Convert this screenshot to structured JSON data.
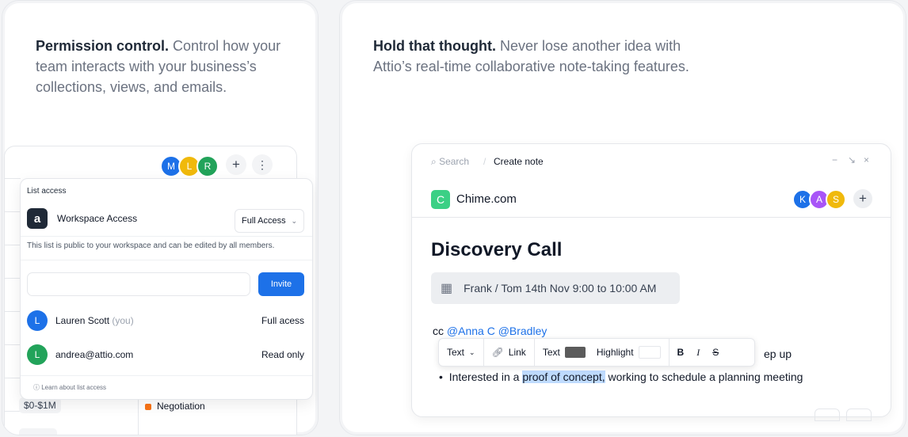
{
  "left_card": {
    "headline_bold": "Permission control.",
    "headline_rest": " Control how your team interacts with your business’s collections, views, and emails.",
    "avatars": [
      {
        "letter": "M",
        "color": "#1d71e8"
      },
      {
        "letter": "L",
        "color": "#f0b90b"
      },
      {
        "letter": "R",
        "color": "#22a35a"
      }
    ],
    "add_icon": "+",
    "more_icon": "⋮",
    "popup": {
      "section_label": "List access",
      "workspace_logo": "a",
      "workspace_label": "Workspace Access",
      "access_select": "Full Access",
      "description": "This list is public to your workspace and can be edited by all members.",
      "invite_placeholder": "",
      "invite_button": "Invite",
      "members": [
        {
          "initial": "L",
          "color": "#1d71e8",
          "name": "Lauren Scott",
          "suffix": "(you)",
          "role": "Full acess"
        },
        {
          "initial": "L",
          "color": "#22a35a",
          "name": "andrea@attio.com",
          "suffix": "",
          "role": "Read only"
        }
      ],
      "learn_more": "Learn about list access"
    },
    "table": {
      "amount_pill": "$0-$1M",
      "stage_label": "Negotiation"
    }
  },
  "right_card": {
    "headline_bold": "Hold that thought.",
    "headline_rest": " Never lose another idea with Attio’s real-time collaborative note-taking features.",
    "note": {
      "search_placeholder": "Search",
      "separator": "/",
      "crumb_current": "Create note",
      "win_minimize": "−",
      "win_collapse": "↘",
      "win_close": "×",
      "company_logo": "C",
      "company_name": "Chime.com",
      "collaborators": [
        {
          "letter": "K",
          "color": "#1d71e8"
        },
        {
          "letter": "A",
          "color": "#a855f7"
        },
        {
          "letter": "S",
          "color": "#f0b90b"
        }
      ],
      "add_icon": "+",
      "title": "Discovery Call",
      "date_chip": "Frank / Tom 14th Nov 9:00 to 10:00 AM",
      "cc_prefix": "cc ",
      "mentions": "@Anna C @Bradley",
      "hidden_tail": "ep up",
      "bullet_pre": "Interested in a ",
      "bullet_highlight": "proof of concept,",
      "bullet_post": " working to schedule a planning meeting",
      "toolbar": {
        "text_style": "Text",
        "link": "Link",
        "text_color_label": "Text",
        "text_color": "#5b5b5b",
        "highlight_label": "Highlight",
        "bold": "B",
        "italic": "I",
        "strike": "S"
      }
    }
  }
}
